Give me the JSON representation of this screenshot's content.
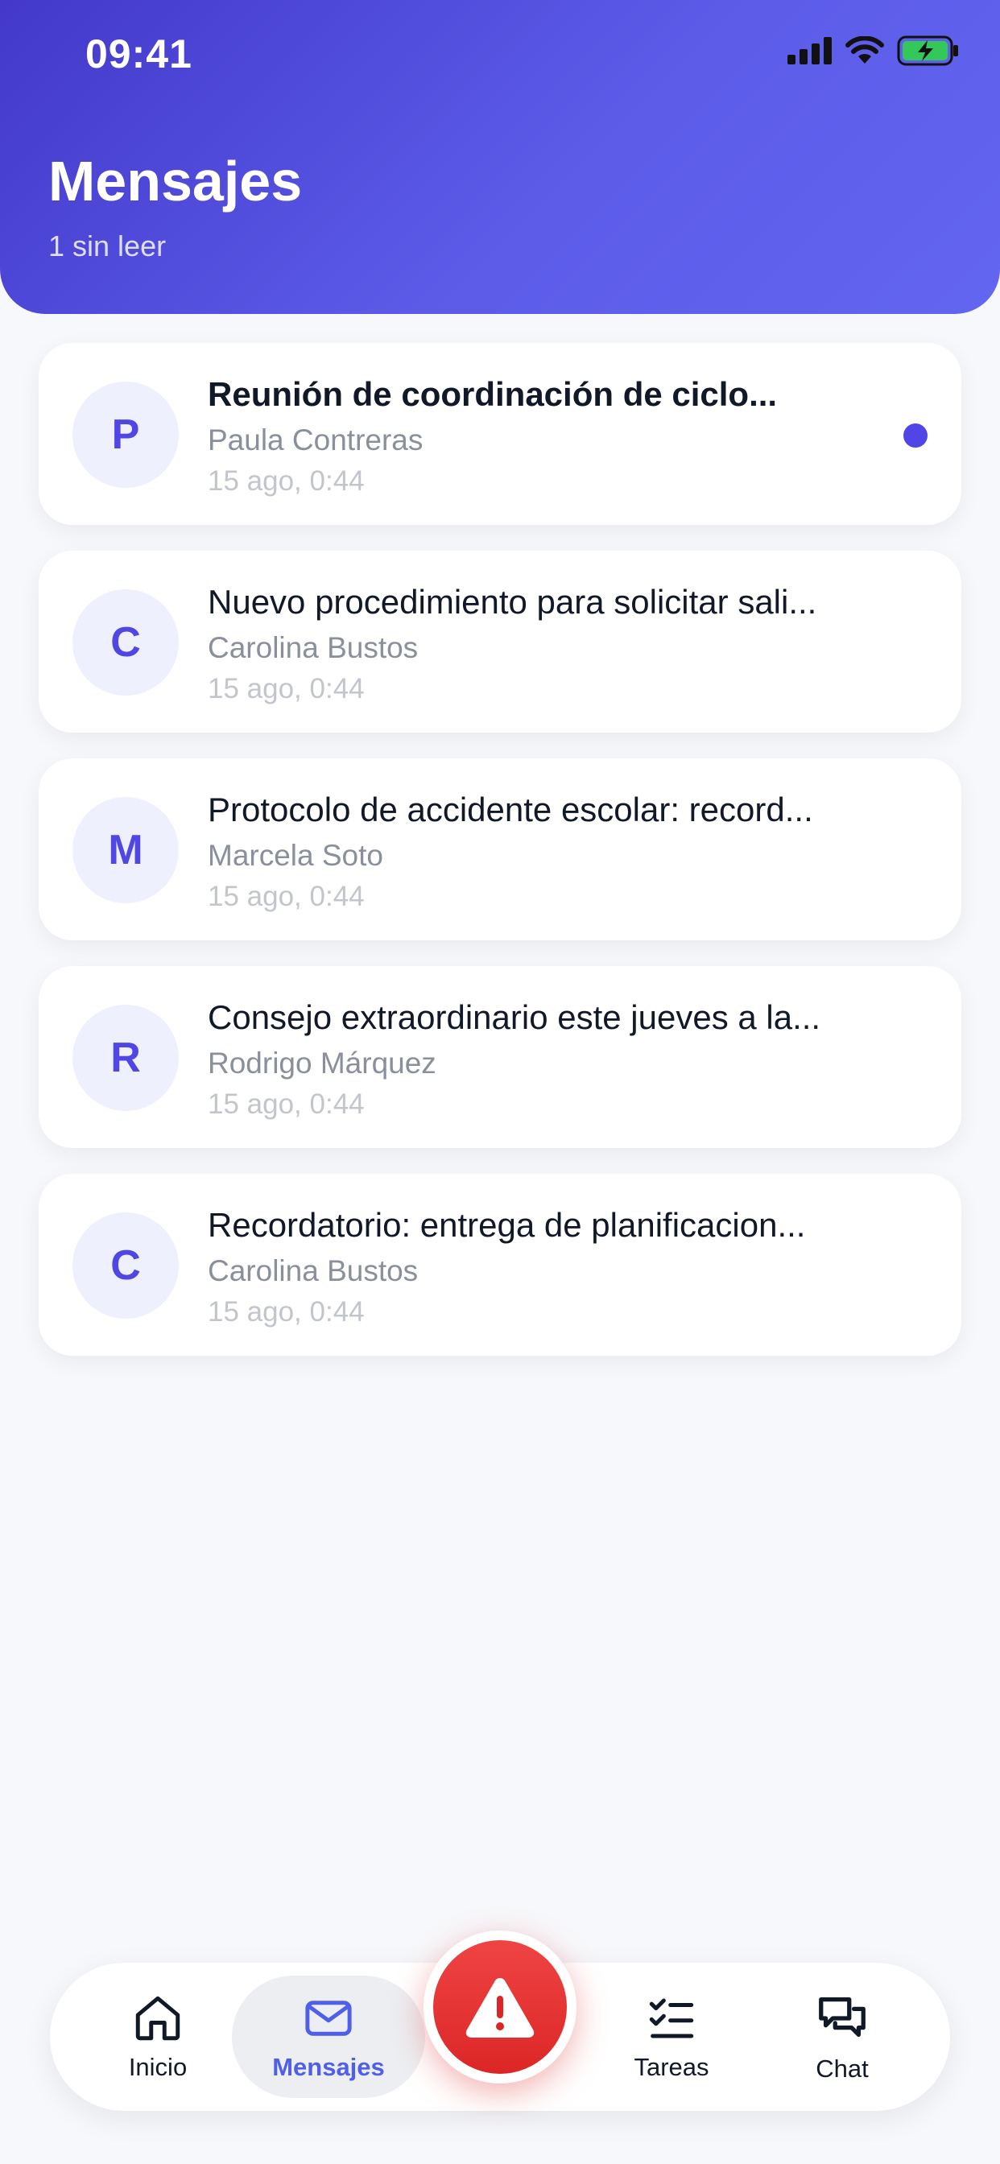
{
  "status_bar": {
    "time": "09:41"
  },
  "header": {
    "title": "Mensajes",
    "subtitle": "1 sin leer"
  },
  "messages": [
    {
      "initial": "P",
      "title": "Reunión de coordinación de ciclo...",
      "sender": "Paula Contreras",
      "time": "15 ago, 0:44",
      "unread": true
    },
    {
      "initial": "C",
      "title": "Nuevo procedimiento para solicitar sali...",
      "sender": "Carolina Bustos",
      "time": "15 ago, 0:44",
      "unread": false
    },
    {
      "initial": "M",
      "title": "Protocolo de accidente escolar: record...",
      "sender": "Marcela Soto",
      "time": "15 ago, 0:44",
      "unread": false
    },
    {
      "initial": "R",
      "title": "Consejo extraordinario este jueves a la...",
      "sender": "Rodrigo Márquez",
      "time": "15 ago, 0:44",
      "unread": false
    },
    {
      "initial": "C",
      "title": "Recordatorio: entrega de planificacion...",
      "sender": "Carolina Bustos",
      "time": "15 ago, 0:44",
      "unread": false
    }
  ],
  "tabbar": {
    "tabs": [
      {
        "label": "Inicio",
        "icon": "home-icon"
      },
      {
        "label": "Mensajes",
        "icon": "mail-icon",
        "active": true
      },
      {
        "label": "Tareas",
        "icon": "checklist-icon"
      },
      {
        "label": "Chat",
        "icon": "chat-bubbles-icon"
      }
    ],
    "emergency_icon": "alert-triangle-icon"
  },
  "colors": {
    "accent": "#4f46e5",
    "header_start": "#4338ca",
    "header_end": "#6366f1",
    "emergency": "#dc2626"
  }
}
